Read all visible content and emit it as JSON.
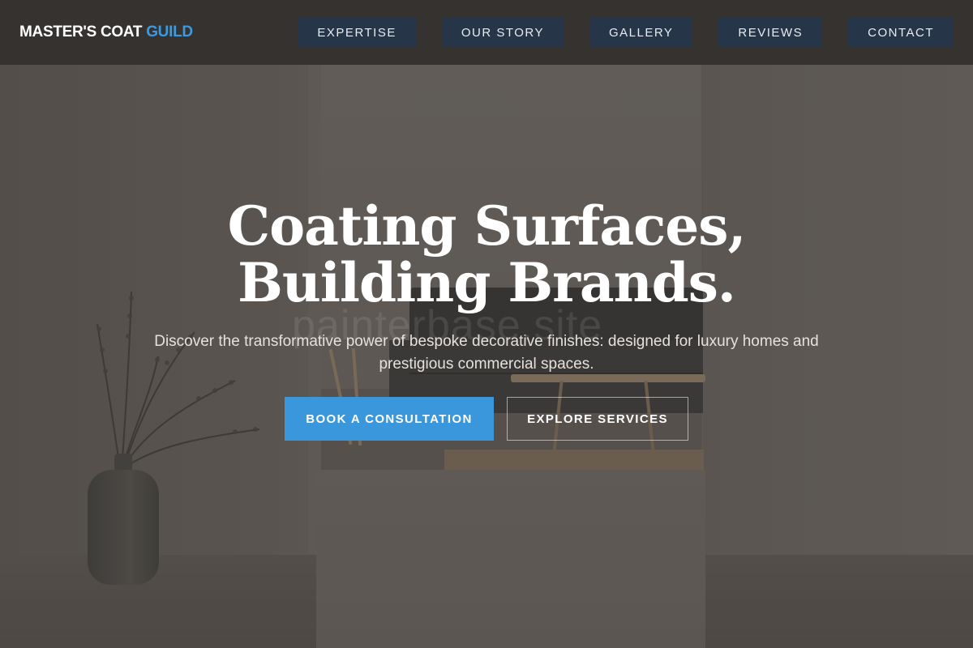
{
  "brand": {
    "name_main": "MASTER'S COAT ",
    "name_accent": "GUILD",
    "accent_color": "#3b9ae0"
  },
  "nav": {
    "items": [
      {
        "label": "EXPERTISE"
      },
      {
        "label": "OUR STORY"
      },
      {
        "label": "GALLERY"
      },
      {
        "label": "REVIEWS"
      },
      {
        "label": "CONTACT"
      }
    ],
    "item_bg_color": "#263548"
  },
  "hero": {
    "headline_line1": "Coating Surfaces,",
    "headline_line2": "Building Brands.",
    "subtext": "Discover the transformative power of bespoke decorative finishes: designed for luxury homes and prestigious commercial spaces.",
    "watermark": "painterbase.site",
    "primary_cta": "BOOK A CONSULTATION",
    "secondary_cta": "EXPLORE SERVICES",
    "primary_cta_color": "#3a97dc"
  }
}
